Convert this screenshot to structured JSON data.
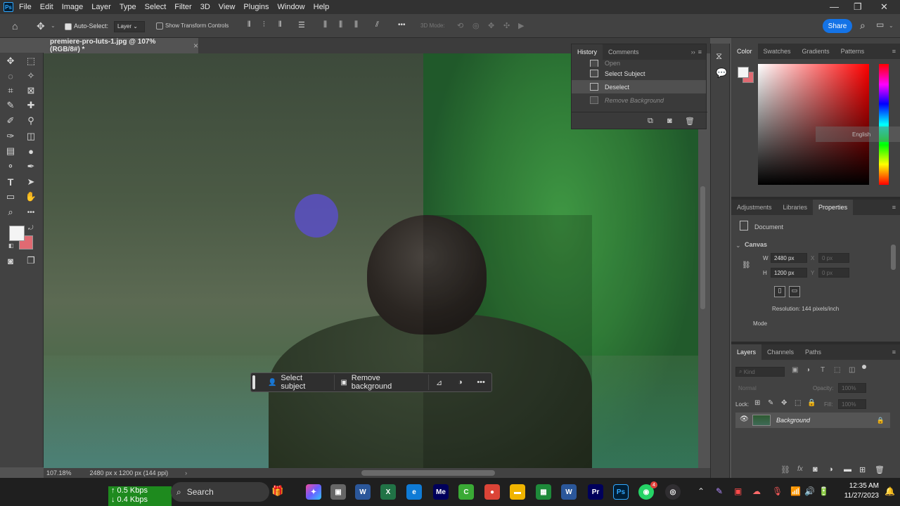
{
  "app": {
    "logo_text": "Ps",
    "menu": [
      "File",
      "Edit",
      "Image",
      "Layer",
      "Type",
      "Select",
      "Filter",
      "3D",
      "View",
      "Plugins",
      "Window",
      "Help"
    ]
  },
  "options_bar": {
    "auto_select_label": "Auto-Select:",
    "auto_select_target": "Layer",
    "show_transform_label": "Show Transform Controls",
    "mode_3d_label": "3D Mode:",
    "share_label": "Share",
    "more_glyph": "•••"
  },
  "document": {
    "tab_title": "premiere-pro-luts-1.jpg @ 107% (RGB/8#) *",
    "close_glyph": "×"
  },
  "context_bar": {
    "select_subject_label": "Select subject",
    "remove_background_label": "Remove background",
    "more_glyph": "•••"
  },
  "status_bar": {
    "zoom": "107.18%",
    "doc_size": "2480 px x 1200 px (144 ppi)"
  },
  "history_panel": {
    "tabs": [
      "History",
      "Comments"
    ],
    "items": [
      {
        "label": "Open",
        "state": "partial"
      },
      {
        "label": "Select Subject",
        "state": "normal"
      },
      {
        "label": "Deselect",
        "state": "active"
      },
      {
        "label": "Remove Background",
        "state": "dim"
      }
    ]
  },
  "color_panel": {
    "tabs": [
      "Color",
      "Swatches",
      "Gradients",
      "Patterns"
    ],
    "foreground": "#f4f4f4",
    "background": "#e06a72",
    "overlay_text": "English"
  },
  "properties_panel": {
    "tabs": [
      "Adjustments",
      "Libraries",
      "Properties"
    ],
    "document_label": "Document",
    "section_label": "Canvas",
    "w_label": "W",
    "w_value": "2480 px",
    "x_label": "X",
    "x_value": "0 px",
    "h_label": "H",
    "h_value": "1200 px",
    "y_label": "Y",
    "y_value": "0 px",
    "resolution": "Resolution: 144 pixels/inch",
    "mode_label": "Mode"
  },
  "layers_panel": {
    "tabs": [
      "Layers",
      "Channels",
      "Paths"
    ],
    "kind_label": "Kind",
    "blend_mode": "Normal",
    "opacity_label": "Opacity:",
    "opacity_value": "100%",
    "lock_label": "Lock:",
    "fill_label": "Fill:",
    "fill_value": "100%",
    "layer_name": "Background"
  },
  "taskbar": {
    "net_up": "↑ 0.5 Kbps",
    "net_down": "↓ 0.4 Kbps",
    "search_label": "Search",
    "apps": [
      {
        "name": "word",
        "glyph": "W",
        "color": "#2b579a"
      },
      {
        "name": "excel",
        "glyph": "X",
        "color": "#217346"
      },
      {
        "name": "edge",
        "glyph": "e",
        "color": "#0f7bd6"
      },
      {
        "name": "media-encoder",
        "glyph": "Me",
        "color": "#00005b"
      },
      {
        "name": "camtasia",
        "glyph": "C",
        "color": "#3aaa35"
      },
      {
        "name": "chrome",
        "glyph": "●",
        "color": "#db4437"
      },
      {
        "name": "explorer",
        "glyph": "▬",
        "color": "#f0b400"
      },
      {
        "name": "money",
        "glyph": "▦",
        "color": "#1e8a3a"
      },
      {
        "name": "word2",
        "glyph": "W",
        "color": "#2b579a"
      },
      {
        "name": "premiere",
        "glyph": "Pr",
        "color": "#00005b"
      },
      {
        "name": "photoshop",
        "glyph": "Ps",
        "color": "#001e36"
      },
      {
        "name": "whatsapp",
        "glyph": "◉",
        "color": "#25d366"
      },
      {
        "name": "obs",
        "glyph": "◎",
        "color": "#302e31"
      }
    ],
    "whatsapp_badge": "4",
    "time": "12:35 AM",
    "date": "11/27/2023"
  }
}
